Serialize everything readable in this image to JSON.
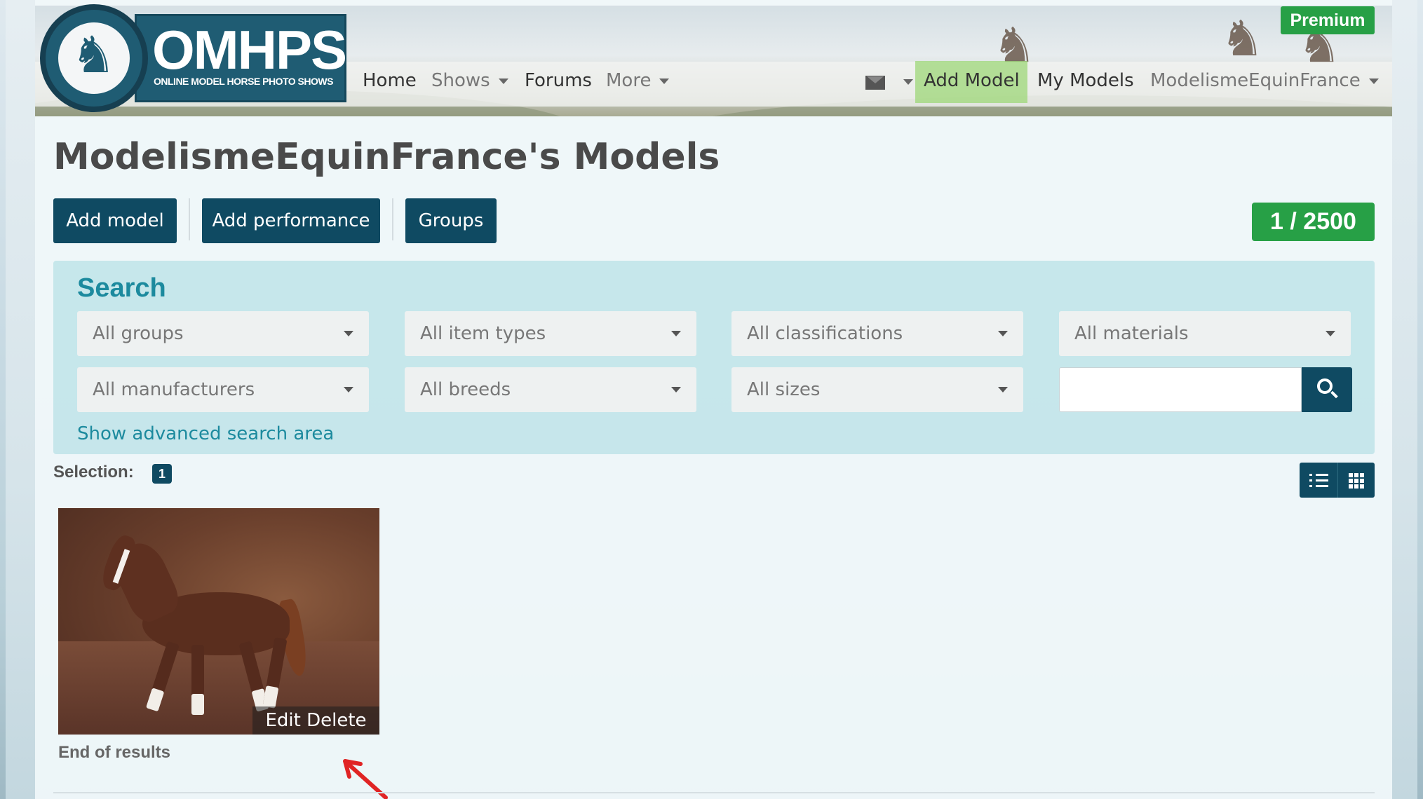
{
  "brand": {
    "logo_title": "OMHPS",
    "logo_subtitle": "ONLINE MODEL HORSE PHOTO SHOWS",
    "premium_label": "Premium"
  },
  "nav": {
    "home": "Home",
    "shows": "Shows",
    "forums": "Forums",
    "more": "More",
    "add_model": "Add Model",
    "my_models": "My Models",
    "user": "ModelismeEquinFrance"
  },
  "page": {
    "title": "ModelismeEquinFrance's Models",
    "buttons": {
      "add_model": "Add model",
      "add_performance": "Add performance",
      "groups": "Groups"
    },
    "model_count": "1 / 2500"
  },
  "search": {
    "title": "Search",
    "filters_row1": [
      "All groups",
      "All item types",
      "All classifications",
      "All materials"
    ],
    "filters_row2": [
      "All manufacturers",
      "All breeds",
      "All sizes"
    ],
    "text_value": "",
    "advanced_link": "Show advanced search area"
  },
  "results": {
    "selection_label": "Selection:",
    "selection_count": "1",
    "card_actions": "Edit Delete",
    "end_text": "End of results"
  },
  "colors": {
    "primary": "#0f4a62",
    "success": "#27a046",
    "accent": "#1c8a9e",
    "annotation": "#e02424"
  },
  "icons": {
    "mail": "envelope-icon",
    "search": "magnifier-icon",
    "list_view": "list-icon",
    "grid_view": "grid-icon",
    "pointer_annotation": "red-arrow-icon"
  }
}
